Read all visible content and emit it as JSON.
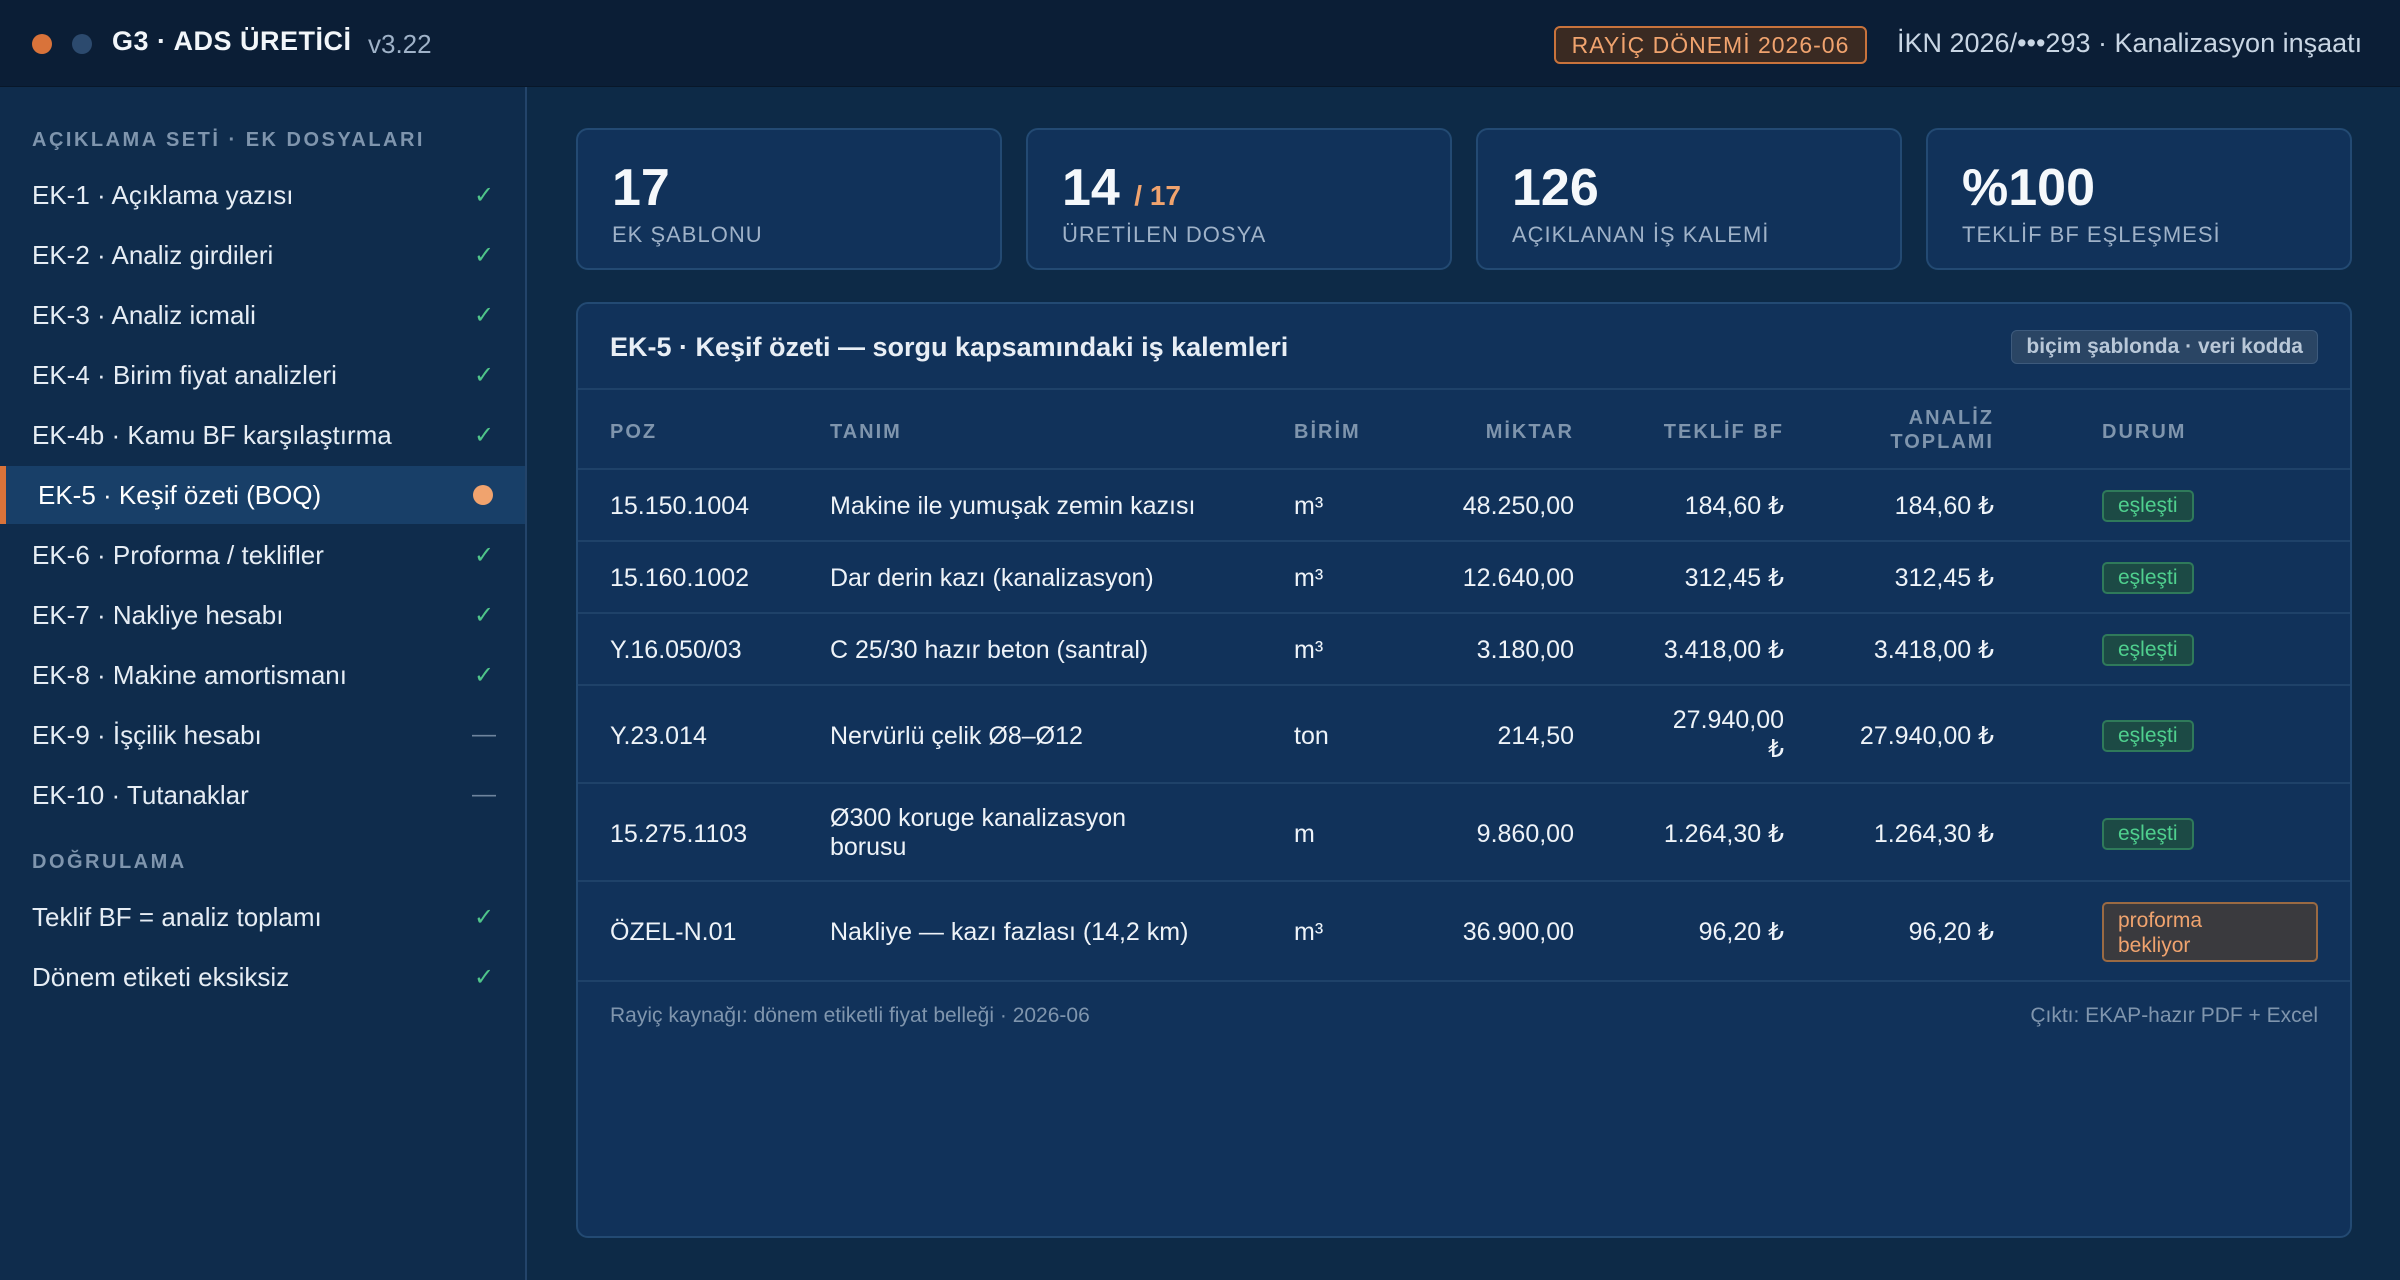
{
  "app": {
    "title": "G3 · ADS ÜRETİCİ",
    "version": "v3.22",
    "period_badge": "RAYİÇ DÖNEMİ 2026-06",
    "project": "İKN 2026/•••293 · Kanalizasyon inşaatı"
  },
  "sidebar": {
    "section_files": "AÇIKLAMA SETİ · EK DOSYALARI",
    "items": [
      {
        "label": "EK-1 · Açıklama yazısı",
        "status": "✓"
      },
      {
        "label": "EK-2 · Analiz girdileri",
        "status": "✓"
      },
      {
        "label": "EK-3 · Analiz icmali",
        "status": "✓"
      },
      {
        "label": "EK-4 · Birim fiyat analizleri",
        "status": "✓"
      },
      {
        "label": "EK-4b · Kamu BF karşılaştırma",
        "status": "✓"
      },
      {
        "label": "EK-5 · Keşif özeti (BOQ)",
        "status": "active"
      },
      {
        "label": "EK-6 · Proforma / teklifler",
        "status": "✓"
      },
      {
        "label": "EK-7 · Nakliye hesabı",
        "status": "✓"
      },
      {
        "label": "EK-8 · Makine amortismanı",
        "status": "✓"
      },
      {
        "label": "EK-9 · İşçilik hesabı",
        "status": "—"
      },
      {
        "label": "EK-10 · Tutanaklar",
        "status": "—"
      }
    ],
    "section_checks": "DOĞRULAMA",
    "checks": [
      {
        "label": "Teklif BF = analiz toplamı",
        "status": "✓"
      },
      {
        "label": "Dönem etiketi eksiksiz",
        "status": "✓"
      }
    ]
  },
  "stats": [
    {
      "value": "17",
      "sub": "",
      "caption": "EK ŞABLONU"
    },
    {
      "value": "14",
      "sub": "/ 17",
      "caption": "ÜRETİLEN DOSYA"
    },
    {
      "value": "126",
      "sub": "",
      "caption": "AÇIKLANAN İŞ KALEMİ"
    },
    {
      "value": "%100",
      "sub": "",
      "caption": "TEKLİF BF EŞLEŞMESİ"
    }
  ],
  "table": {
    "title": "EK-5 · Keşif özeti — sorgu kapsamındaki iş kalemleri",
    "tag": "biçim şablonda · veri kodda",
    "headers": {
      "poz": "POZ",
      "tanim": "TANIM",
      "birim": "BİRİM",
      "miktar": "MİKTAR",
      "teklif": "TEKLİF BF",
      "analiz_1": "ANALİZ",
      "analiz_2": "TOPLAMI",
      "durum": "DURUM"
    },
    "rows": [
      {
        "poz": "15.150.1004",
        "tanim": "Makine ile yumuşak zemin kazısı",
        "tanim2": "",
        "birim": "m³",
        "miktar": "48.250,00",
        "teklif": "184,60 ₺",
        "teklif2": "",
        "analiz": "184,60 ₺",
        "durum": "eşleşti",
        "durum2": ""
      },
      {
        "poz": "15.160.1002",
        "tanim": "Dar derin kazı (kanalizasyon)",
        "tanim2": "",
        "birim": "m³",
        "miktar": "12.640,00",
        "teklif": "312,45 ₺",
        "teklif2": "",
        "analiz": "312,45 ₺",
        "durum": "eşleşti",
        "durum2": ""
      },
      {
        "poz": "Y.16.050/03",
        "tanim": "C 25/30 hazır beton (santral)",
        "tanim2": "",
        "birim": "m³",
        "miktar": "3.180,00",
        "teklif": "3.418,00 ₺",
        "teklif2": "",
        "analiz": "3.418,00 ₺",
        "durum": "eşleşti",
        "durum2": ""
      },
      {
        "poz": "Y.23.014",
        "tanim": "Nervürlü çelik Ø8–Ø12",
        "tanim2": "",
        "birim": "ton",
        "miktar": "214,50",
        "teklif": "27.940,00",
        "teklif2": "₺",
        "analiz": "27.940,00 ₺",
        "durum": "eşleşti",
        "durum2": ""
      },
      {
        "poz": "15.275.1103",
        "tanim": "Ø300 koruge kanalizasyon",
        "tanim2": "borusu",
        "birim": "m",
        "miktar": "9.860,00",
        "teklif": "1.264,30 ₺",
        "teklif2": "",
        "analiz": "1.264,30 ₺",
        "durum": "eşleşti",
        "durum2": ""
      },
      {
        "poz": "ÖZEL-N.01",
        "tanim": "Nakliye — kazı fazlası (14,2 km)",
        "tanim2": "",
        "birim": "m³",
        "miktar": "36.900,00",
        "teklif": "96,20 ₺",
        "teklif2": "",
        "analiz": "96,20 ₺",
        "durum": "proforma",
        "durum2": "bekliyor"
      }
    ],
    "footer_left": "Rayiç kaynağı: dönem etiketli fiyat belleği · 2026-06",
    "footer_right": "Çıktı: EKAP-hazır PDF + Excel"
  },
  "colors": {
    "accent": "#d9733a",
    "ok": "#4fc48a",
    "pending": "#f0a36e",
    "background": "#0d2a47"
  }
}
